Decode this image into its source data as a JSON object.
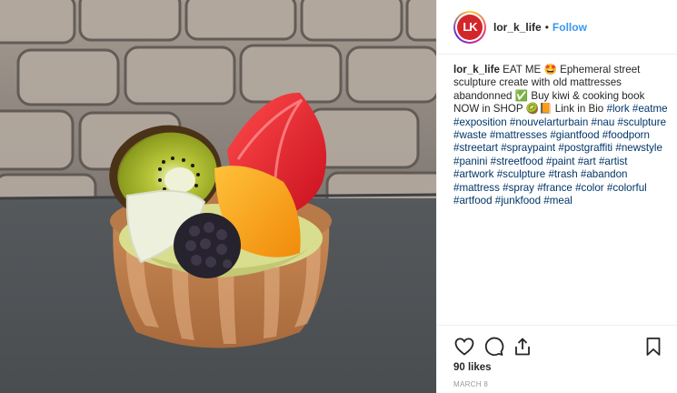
{
  "post": {
    "username": "lor_k_life",
    "separator": "•",
    "follow_label": "Follow",
    "avatar_text": "LK",
    "caption": {
      "username": "lor_k_life",
      "text": "EAT ME 🤩 Ephemeral street sculpture create with old mattresses abandonned ✅ Buy kiwi & cooking book NOW in SHOP 🥝📙 Link in Bio",
      "hashtags": [
        "#lork",
        "#eatme",
        "#exposition",
        "#nouvelarturbain",
        "#nau",
        "#sculpture",
        "#waste",
        "#mattresses",
        "#giantfood",
        "#foodporn",
        "#streetart",
        "#spraypaint",
        "#postgraffiti",
        "#newstyle",
        "#panini",
        "#streetfood",
        "#paint",
        "#art",
        "#artist",
        "#artwork",
        "#sculpture",
        "#trash",
        "#abandon",
        "#mattress",
        "#spray",
        "#france",
        "#color",
        "#colorful",
        "#artfood",
        "#junkfood",
        "#meal"
      ]
    },
    "likes": "90 likes",
    "date": "MARCH 8"
  },
  "icons": {
    "like": "heart-icon",
    "comment": "comment-icon",
    "share": "share-icon",
    "save": "bookmark-icon"
  },
  "colors": {
    "link": "#003569",
    "follow": "#3897f0",
    "avatar": "#d3262b"
  }
}
